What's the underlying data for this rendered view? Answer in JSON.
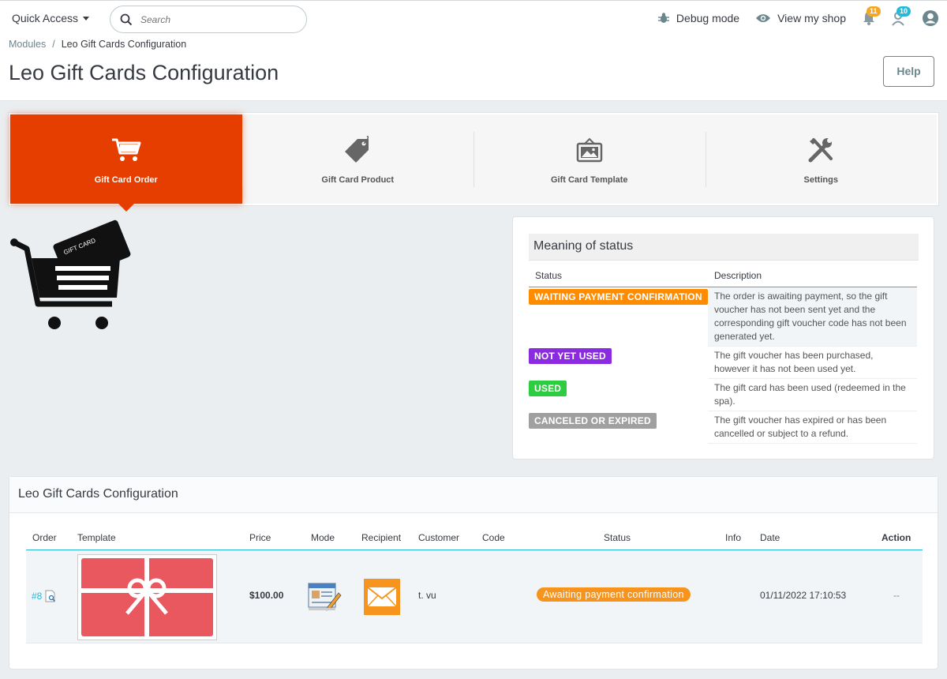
{
  "header": {
    "quick_access": "Quick Access",
    "search_placeholder": "Search",
    "debug_mode": "Debug mode",
    "view_shop": "View my shop",
    "orders_badge": "11",
    "customers_badge": "10"
  },
  "breadcrumb": {
    "parent": "Modules",
    "separator": "/",
    "current": "Leo Gift Cards Configuration"
  },
  "page_title": "Leo Gift Cards Configuration",
  "help_label": "Help",
  "tabs": [
    {
      "label": "Gift Card Order",
      "icon": "cart-icon",
      "active": true
    },
    {
      "label": "Gift Card Product",
      "icon": "tag-icon",
      "active": false
    },
    {
      "label": "Gift Card Template",
      "icon": "picture-icon",
      "active": false
    },
    {
      "label": "Settings",
      "icon": "tools-icon",
      "active": false
    }
  ],
  "illustration": {
    "card_text": "GIFT CARD"
  },
  "status_meaning": {
    "title": "Meaning of status",
    "col_status": "Status",
    "col_description": "Description",
    "rows": [
      {
        "label": "WAITING PAYMENT CONFIRMATION",
        "color": "#ff8c00",
        "description": "The order is awaiting payment, so the gift voucher has not been sent yet and the corresponding gift voucher code has not been generated yet."
      },
      {
        "label": "NOT YET USED",
        "color": "#8a2be2",
        "description": "The gift voucher has been purchased, however it has not been used yet."
      },
      {
        "label": "USED",
        "color": "#2ecc40",
        "description": "The gift card has been used (redeemed in the spa)."
      },
      {
        "label": "CANCELED OR EXPIRED",
        "color": "#a0a0a0",
        "description": "The gift voucher has expired or has been cancelled or subject to a refund."
      }
    ]
  },
  "orders": {
    "heading": "Leo Gift Cards Configuration",
    "columns": {
      "order": "Order",
      "template": "Template",
      "price": "Price",
      "mode": "Mode",
      "recipient": "Recipient",
      "customer": "Customer",
      "code": "Code",
      "status": "Status",
      "info": "Info",
      "date": "Date",
      "action": "Action"
    },
    "rows": [
      {
        "order": "#8",
        "price": "$100.00",
        "mode_icon": "edit-form-icon",
        "recipient_icon": "envelope-icon",
        "customer": "t. vu",
        "code": "",
        "status": "Awaiting payment confirmation",
        "status_color": "#f7941d",
        "info": "",
        "date": "01/11/2022 17:10:53",
        "action": "--"
      }
    ]
  }
}
